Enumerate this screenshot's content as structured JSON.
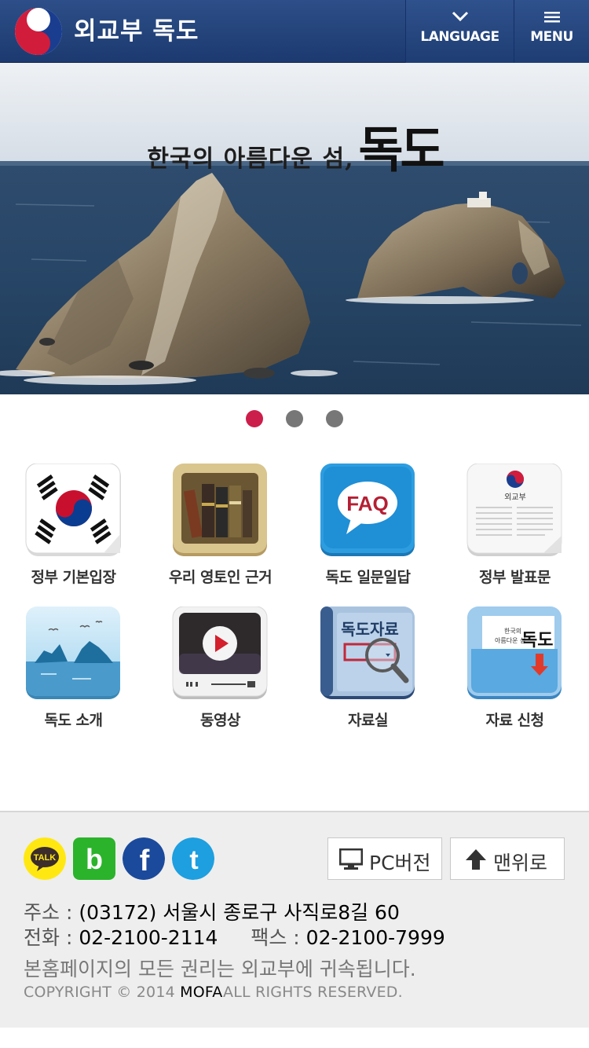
{
  "header": {
    "site_title": "외교부 독도",
    "language_label": "LANGUAGE",
    "menu_label": "MENU"
  },
  "hero": {
    "caption_prefix": "한국의 아름다운 섬,",
    "caption_main": "독도",
    "slides_total": 3,
    "active_slide": 1
  },
  "menu_items": [
    {
      "label": "정부 기본입장",
      "icon": "korean-flag-icon"
    },
    {
      "label": "우리 영토인 근거",
      "icon": "books-icon"
    },
    {
      "label": "독도 일문일답",
      "icon": "faq-icon"
    },
    {
      "label": "정부 발표문",
      "icon": "document-icon"
    },
    {
      "label": "독도 소개",
      "icon": "dokdo-island-icon"
    },
    {
      "label": "동영상",
      "icon": "video-play-icon"
    },
    {
      "label": "자료실",
      "icon": "archive-search-icon"
    },
    {
      "label": "자료 신청",
      "icon": "folder-request-icon"
    }
  ],
  "tile_texts": {
    "faq": "FAQ",
    "document_header": "외교부",
    "archive_title": "독도자료"
  },
  "footer": {
    "social": [
      {
        "name": "kakaotalk",
        "label": "TALK",
        "color": "#ffe812"
      },
      {
        "name": "band",
        "label": "b",
        "color": "#2bb32b"
      },
      {
        "name": "facebook",
        "label": "f",
        "color": "#1b4a9c"
      },
      {
        "name": "twitter",
        "label": "t",
        "color": "#1d9fe0"
      }
    ],
    "pc_version_label": "PC버전",
    "top_label": "맨위로",
    "address_key": "주소 :",
    "address_value": "(03172) 서울시 종로구 사직로8길 60",
    "phone_key": "전화 :",
    "phone_value": "02-2100-2114",
    "fax_key": "팩스 :",
    "fax_value": "02-2100-7999",
    "rights_text": "본홈페이지의 모든 권리는 외교부에 귀속됩니다.",
    "copyright_prefix": "COPYRIGHT © 2014",
    "copyright_org": "MOFA",
    "copyright_suffix": "ALL RIGHTS RESERVED."
  },
  "colors": {
    "header": "#234580",
    "pager_active": "#cc1e4a",
    "pager_inactive": "#777777",
    "footer_bg": "#eeeeee"
  }
}
